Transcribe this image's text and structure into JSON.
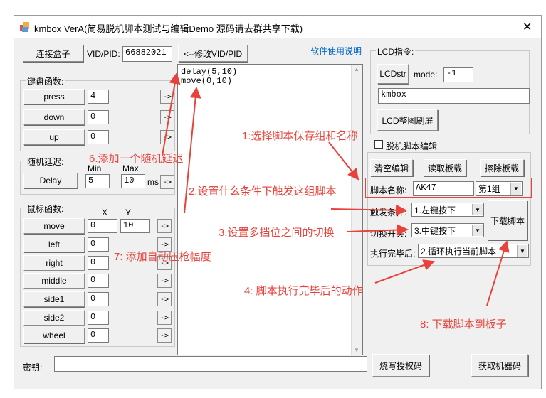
{
  "window": {
    "title": "kmbox VerA(简易脱机脚本测试与编辑Demo 源码请去群共享下载)",
    "close_glyph": "✕"
  },
  "top": {
    "connect_label": "连接盒子",
    "vidpid_label": "VID/PID:",
    "vidpid_value": "66882021",
    "modify_label": "<--修改VID/PID",
    "help_link": "软件使用说明"
  },
  "keyboard": {
    "group_title": "键盘函数:",
    "rows": [
      {
        "label": "press",
        "value": "4",
        "arrow": "->"
      },
      {
        "label": "down",
        "value": "0",
        "arrow": "->"
      },
      {
        "label": "up",
        "value": "0",
        "arrow": "->"
      }
    ]
  },
  "random_delay": {
    "group_title": "随机延迟:",
    "min_label": "Min",
    "max_label": "Max",
    "button_label": "Delay",
    "min_value": "5",
    "max_value": "10",
    "unit": "ms",
    "arrow": "->"
  },
  "mouse": {
    "group_title": "鼠标函数:",
    "x_label": "X",
    "y_label": "Y",
    "rows": [
      {
        "label": "move",
        "x": "0",
        "y": "10",
        "arrow": "->"
      },
      {
        "label": "left",
        "x": "0",
        "arrow": "->"
      },
      {
        "label": "right",
        "x": "0",
        "arrow": "->"
      },
      {
        "label": "middle",
        "x": "0",
        "arrow": "->"
      },
      {
        "label": "side1",
        "x": "0",
        "arrow": "->"
      },
      {
        "label": "side2",
        "x": "0",
        "arrow": "->"
      },
      {
        "label": "wheel",
        "x": "0",
        "arrow": "->"
      }
    ]
  },
  "script_editor": {
    "text": "delay(5,10)\nmove(0,10)"
  },
  "lcd": {
    "group_title": "LCD指令:",
    "lcdstr_label": "LCDstr",
    "mode_label": "mode:",
    "mode_value": "-1",
    "text_value": "kmbox",
    "refresh_label": "LCD整图刷屏"
  },
  "offline": {
    "checkbox_label": "脱机脚本编辑",
    "clear_label": "清空编辑",
    "read_label": "读取板载",
    "erase_label": "擦除板载",
    "name_label": "脚本名称:",
    "name_value": "AK47",
    "group_value": "第1组",
    "trigger_label": "触发条件:",
    "trigger_value": "1.左键按下",
    "switch_label": "切换开关:",
    "switch_value": "3.中键按下",
    "download_label": "下载脚本",
    "finish_label": "执行完毕后:",
    "finish_value": "2.循环执行当前脚本"
  },
  "bottom": {
    "key_label": "密钥:",
    "key_value": "",
    "burn_label": "烧写授权码",
    "machine_label": "获取机器码"
  },
  "annotations": {
    "a1": "1:选择脚本保存组和名称",
    "a2": "2.设置什么条件下触发这组脚本",
    "a3": "3.设置多挡位之间的切换",
    "a4": "4:  脚本执行完毕后的动作",
    "a6": "6.添加一个随机延迟",
    "a7": "7:  添加自动压枪幅度",
    "a8": "8:  下载脚本到板子"
  },
  "colors": {
    "annotation": "#e8423b",
    "link": "#0066cc",
    "highlight_border": "#e8423b"
  }
}
